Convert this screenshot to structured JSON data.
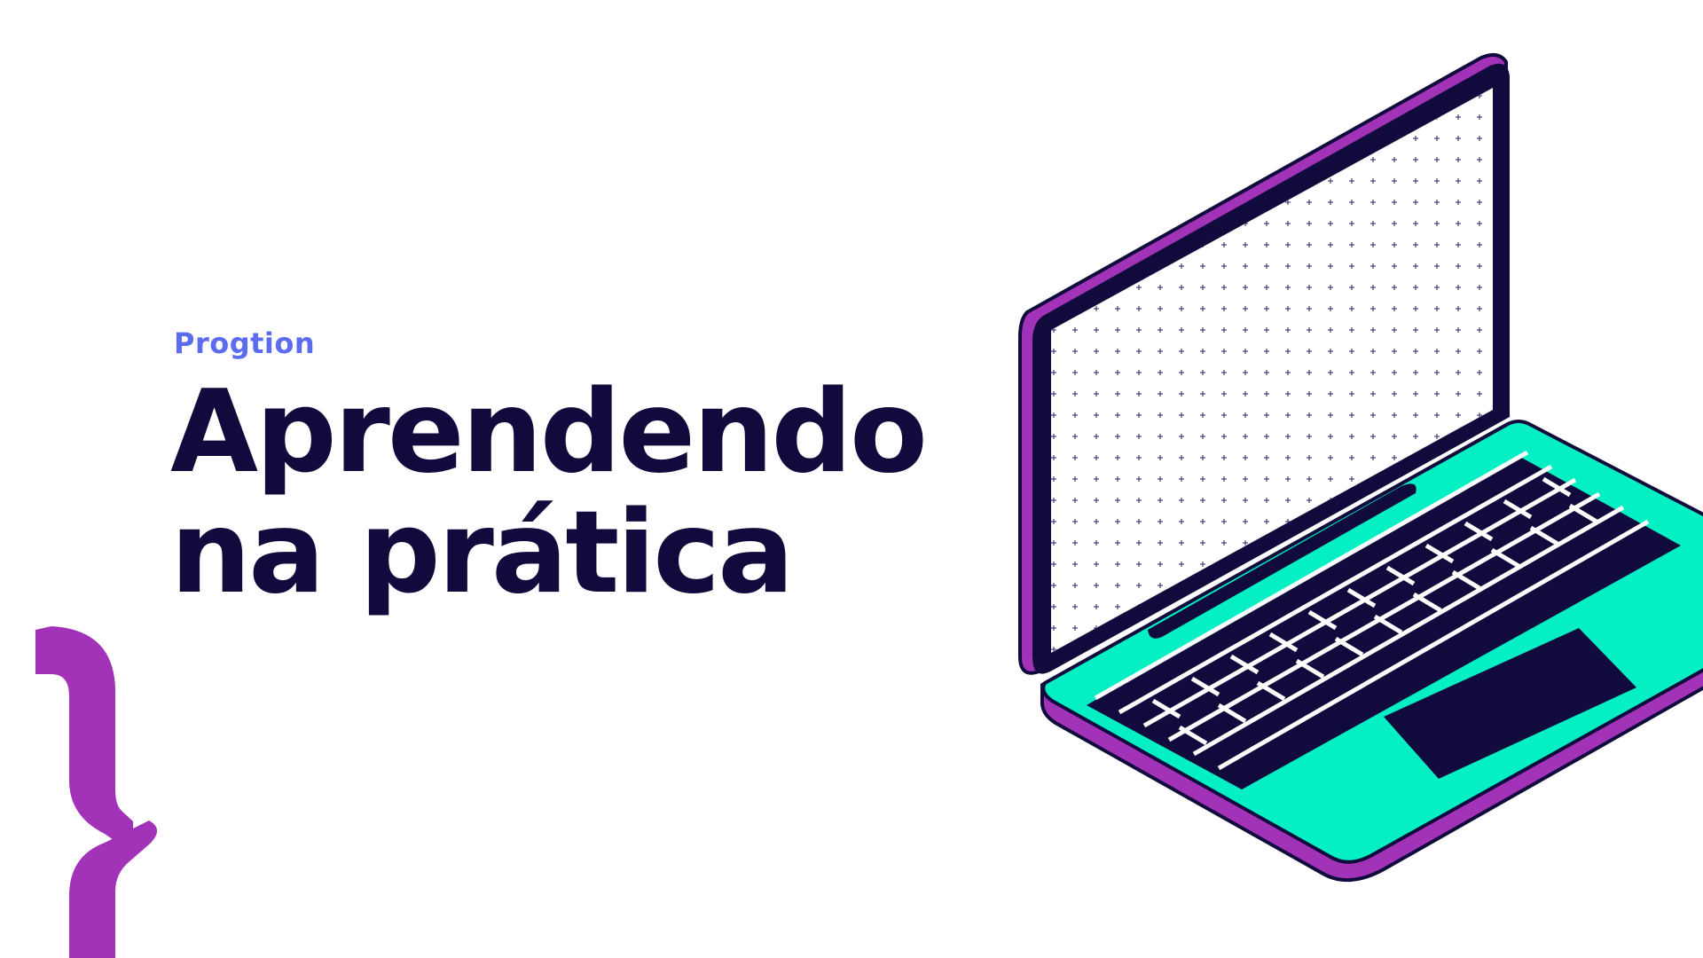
{
  "brand": {
    "name": "Progtion"
  },
  "headline": {
    "line1": "Aprendendo",
    "line2": "na prática"
  },
  "illustration": {
    "subject": "laptop-illustration",
    "decoration": "curly-brace-icon"
  },
  "colors": {
    "background": "#ffffff",
    "brand_text": "#5b6cf0",
    "headline_text": "#110b3d",
    "accent_purple": "#a233b8",
    "accent_teal": "#05efc5",
    "outline_navy": "#110b3d"
  }
}
